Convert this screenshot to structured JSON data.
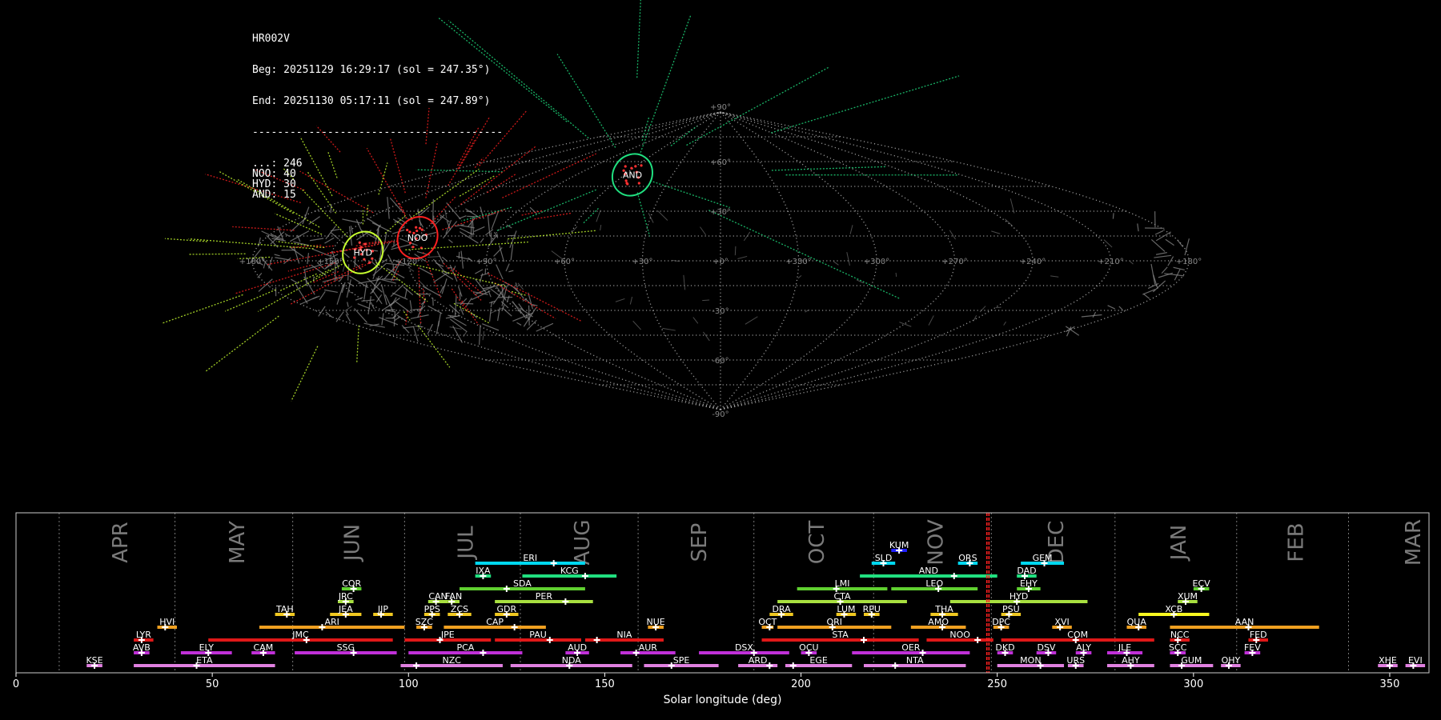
{
  "info": {
    "station": "HR002V",
    "beg": "Beg: 20251129 16:29:17 (sol = 247.35°)",
    "end": "End: 20251130 05:17:11 (sol = 247.89°)",
    "separator": "----------------------------------------",
    "counts": [
      {
        "label": "...",
        "value": 246
      },
      {
        "label": "NOO",
        "value": 40
      },
      {
        "label": "HYD",
        "value": 30
      },
      {
        "label": "AND",
        "value": 15
      }
    ]
  },
  "sky_map": {
    "projection": "sinusoidal",
    "lat_labels": [
      "+90°",
      "+60°",
      "+30°",
      "-30°",
      "-60°",
      "-90°"
    ],
    "lon_labels": [
      "+180°",
      "+150°",
      "+120°",
      "+90°",
      "+60°",
      "+30°",
      "+0°",
      "+330°",
      "+300°",
      "+270°",
      "+240°",
      "+210°",
      "+180°"
    ],
    "colors": {
      "sporadic": "#888888",
      "noo": "#ff2020",
      "hyd": "#c8ff30",
      "and": "#20e080"
    },
    "radiants": [
      {
        "code": "AND",
        "lon": 55,
        "lat": 52,
        "color": "#20e080",
        "count": 15
      },
      {
        "code": "NOO",
        "lon": 120,
        "lat": 14,
        "color": "#ff2020",
        "count": 40
      },
      {
        "code": "HYD",
        "lon": 138,
        "lat": 5,
        "color": "#c8ff30",
        "count": 30
      }
    ]
  },
  "chart_data": {
    "type": "timeline",
    "xlabel": "Solar longitude (deg)",
    "xlim": [
      0,
      360
    ],
    "xticks": [
      0,
      50,
      100,
      150,
      200,
      250,
      300,
      350
    ],
    "current_sol": [
      247.35,
      247.89
    ],
    "months": [
      {
        "name": "APR",
        "start": 11
      },
      {
        "name": "MAY",
        "start": 40.5
      },
      {
        "name": "JUN",
        "start": 70.5
      },
      {
        "name": "JUL",
        "start": 99
      },
      {
        "name": "AUG",
        "start": 128.5
      },
      {
        "name": "SEP",
        "start": 158.5
      },
      {
        "name": "OCT",
        "start": 188
      },
      {
        "name": "NOV",
        "start": 218.5
      },
      {
        "name": "DEC",
        "start": 248.5
      },
      {
        "name": "JAN",
        "start": 280
      },
      {
        "name": "FEB",
        "start": 311
      },
      {
        "name": "MAR",
        "start": 339.5
      }
    ],
    "showers": [
      {
        "code": "KUM",
        "start": 223,
        "end": 227,
        "peak": 225,
        "row": 9,
        "color": "#2020ff"
      },
      {
        "code": "ERI",
        "start": 117,
        "end": 145,
        "peak": 137,
        "row": 8,
        "color": "#00d8f0"
      },
      {
        "code": "SLD",
        "start": 218,
        "end": 224,
        "peak": 221,
        "row": 8,
        "color": "#00d8f0"
      },
      {
        "code": "ORS",
        "start": 240,
        "end": 245,
        "peak": 243,
        "row": 8,
        "color": "#00d8f0"
      },
      {
        "code": "GEM",
        "start": 256,
        "end": 267,
        "peak": 262,
        "row": 8,
        "color": "#00d8f0"
      },
      {
        "code": "IXA",
        "start": 117,
        "end": 121,
        "peak": 119,
        "row": 7,
        "color": "#20e080"
      },
      {
        "code": "KCG",
        "start": 129,
        "end": 153,
        "peak": 145,
        "row": 7,
        "color": "#20e080"
      },
      {
        "code": "AND",
        "start": 215,
        "end": 250,
        "peak": 239,
        "row": 7,
        "color": "#20e080"
      },
      {
        "code": "DAD",
        "start": 255,
        "end": 260,
        "peak": 257,
        "row": 7,
        "color": "#20e080"
      },
      {
        "code": "COR",
        "start": 83,
        "end": 88,
        "peak": 86,
        "row": 6,
        "color": "#60d030"
      },
      {
        "code": "SDA",
        "start": 113,
        "end": 145,
        "peak": 125,
        "row": 6,
        "color": "#60d030"
      },
      {
        "code": "LMI",
        "start": 199,
        "end": 222,
        "peak": 209,
        "row": 6,
        "color": "#60d030"
      },
      {
        "code": "LEO",
        "start": 223,
        "end": 245,
        "peak": 235,
        "row": 6,
        "color": "#60d030"
      },
      {
        "code": "EHY",
        "start": 255,
        "end": 261,
        "peak": 258,
        "row": 6,
        "color": "#60d030"
      },
      {
        "code": "ECV",
        "start": 300,
        "end": 304,
        "peak": 302,
        "row": 6,
        "color": "#60d030"
      },
      {
        "code": "JRC",
        "start": 82,
        "end": 86,
        "peak": 84,
        "row": 5,
        "color": "#a8e040"
      },
      {
        "code": "CAN",
        "start": 105,
        "end": 110,
        "peak": 107,
        "row": 5,
        "color": "#a8e040"
      },
      {
        "code": "FAN",
        "start": 110,
        "end": 113,
        "peak": 111,
        "row": 5,
        "color": "#a8e040"
      },
      {
        "code": "PER",
        "start": 122,
        "end": 147,
        "peak": 140,
        "row": 5,
        "color": "#a8e040"
      },
      {
        "code": "CTA",
        "start": 194,
        "end": 227,
        "peak": 210,
        "row": 5,
        "color": "#a8e040"
      },
      {
        "code": "HYD",
        "start": 238,
        "end": 273,
        "peak": 255,
        "row": 5,
        "color": "#a8e040"
      },
      {
        "code": "XUM",
        "start": 296,
        "end": 301,
        "peak": 298,
        "row": 5,
        "color": "#a8e040"
      },
      {
        "code": "TAH",
        "start": 66,
        "end": 71,
        "peak": 69,
        "row": 4,
        "color": "#f0c820"
      },
      {
        "code": "JEA",
        "start": 80,
        "end": 88,
        "peak": 84,
        "row": 4,
        "color": "#f0c820"
      },
      {
        "code": "JIP",
        "start": 91,
        "end": 96,
        "peak": 93,
        "row": 4,
        "color": "#f0c820"
      },
      {
        "code": "PPS",
        "start": 104,
        "end": 108,
        "peak": 106,
        "row": 4,
        "color": "#f0c820"
      },
      {
        "code": "ZCS",
        "start": 110,
        "end": 116,
        "peak": 113,
        "row": 4,
        "color": "#f0c820"
      },
      {
        "code": "GDR",
        "start": 122,
        "end": 128,
        "peak": 125,
        "row": 4,
        "color": "#f0c820"
      },
      {
        "code": "DRA",
        "start": 192,
        "end": 198,
        "peak": 195,
        "row": 4,
        "color": "#f0c820"
      },
      {
        "code": "LUM",
        "start": 209,
        "end": 214,
        "peak": 211,
        "row": 4,
        "color": "#f0c820"
      },
      {
        "code": "RPU",
        "start": 216,
        "end": 220,
        "peak": 218,
        "row": 4,
        "color": "#f0c820"
      },
      {
        "code": "THA",
        "start": 233,
        "end": 240,
        "peak": 236,
        "row": 4,
        "color": "#f0c820"
      },
      {
        "code": "PSU",
        "start": 251,
        "end": 256,
        "peak": 253,
        "row": 4,
        "color": "#f0c820"
      },
      {
        "code": "XCB",
        "start": 286,
        "end": 304,
        "peak": 295,
        "row": 4,
        "color": "#f8f820"
      },
      {
        "code": "HVI",
        "start": 36,
        "end": 41,
        "peak": 38,
        "row": 3,
        "color": "#f0a020"
      },
      {
        "code": "ARI",
        "start": 62,
        "end": 99,
        "peak": 78,
        "row": 3,
        "color": "#f0a020"
      },
      {
        "code": "SZC",
        "start": 102,
        "end": 106,
        "peak": 104,
        "row": 3,
        "color": "#f0a020"
      },
      {
        "code": "CAP",
        "start": 109,
        "end": 135,
        "peak": 127,
        "row": 3,
        "color": "#f0a020"
      },
      {
        "code": "NUE",
        "start": 161,
        "end": 165,
        "peak": 163,
        "row": 3,
        "color": "#f0a020"
      },
      {
        "code": "OCT",
        "start": 190,
        "end": 193,
        "peak": 192,
        "row": 3,
        "color": "#f0a020"
      },
      {
        "code": "ORI",
        "start": 194,
        "end": 223,
        "peak": 208,
        "row": 3,
        "color": "#f0a020"
      },
      {
        "code": "AMO",
        "start": 228,
        "end": 242,
        "peak": 236,
        "row": 3,
        "color": "#f0a020"
      },
      {
        "code": "DPC",
        "start": 249,
        "end": 253,
        "peak": 251,
        "row": 3,
        "color": "#f0a020"
      },
      {
        "code": "XVI",
        "start": 264,
        "end": 269,
        "peak": 266,
        "row": 3,
        "color": "#f0a020"
      },
      {
        "code": "QUA",
        "start": 283,
        "end": 288,
        "peak": 286,
        "row": 3,
        "color": "#f0a020"
      },
      {
        "code": "AAN",
        "start": 294,
        "end": 332,
        "peak": 314,
        "row": 3,
        "color": "#f0a020"
      },
      {
        "code": "LYR",
        "start": 30,
        "end": 35,
        "peak": 32,
        "row": 2,
        "color": "#e01818"
      },
      {
        "code": "JMC",
        "start": 49,
        "end": 96,
        "peak": 74,
        "row": 2,
        "color": "#e01818"
      },
      {
        "code": "JPE",
        "start": 99,
        "end": 121,
        "peak": 108,
        "row": 2,
        "color": "#e01818"
      },
      {
        "code": "PAU",
        "start": 122,
        "end": 144,
        "peak": 136,
        "row": 2,
        "color": "#e01818"
      },
      {
        "code": "NIA",
        "start": 145,
        "end": 165,
        "peak": 148,
        "row": 2,
        "color": "#e01818"
      },
      {
        "code": "STA",
        "start": 190,
        "end": 230,
        "peak": 216,
        "row": 2,
        "color": "#e01818"
      },
      {
        "code": "NOO",
        "start": 232,
        "end": 249,
        "peak": 245,
        "row": 2,
        "color": "#e01818"
      },
      {
        "code": "COM",
        "start": 251,
        "end": 290,
        "peak": 270,
        "row": 2,
        "color": "#e01818"
      },
      {
        "code": "NCC",
        "start": 294,
        "end": 299,
        "peak": 296,
        "row": 2,
        "color": "#e01818"
      },
      {
        "code": "FED",
        "start": 314,
        "end": 319,
        "peak": 316,
        "row": 2,
        "color": "#e01818"
      },
      {
        "code": "AVB",
        "start": 30,
        "end": 34,
        "peak": 32,
        "row": 1,
        "color": "#c030d8"
      },
      {
        "code": "ELY",
        "start": 42,
        "end": 55,
        "peak": 49,
        "row": 1,
        "color": "#c030d8"
      },
      {
        "code": "CAM",
        "start": 60,
        "end": 66,
        "peak": 63,
        "row": 1,
        "color": "#c030d8"
      },
      {
        "code": "SSG",
        "start": 71,
        "end": 97,
        "peak": 86,
        "row": 1,
        "color": "#c030d8"
      },
      {
        "code": "PCA",
        "start": 100,
        "end": 129,
        "peak": 119,
        "row": 1,
        "color": "#c030d8"
      },
      {
        "code": "AUD",
        "start": 140,
        "end": 146,
        "peak": 143,
        "row": 1,
        "color": "#c030d8"
      },
      {
        "code": "AUR",
        "start": 154,
        "end": 168,
        "peak": 158,
        "row": 1,
        "color": "#c030d8"
      },
      {
        "code": "DSX",
        "start": 174,
        "end": 197,
        "peak": 188,
        "row": 1,
        "color": "#c030d8"
      },
      {
        "code": "OCU",
        "start": 200,
        "end": 204,
        "peak": 202,
        "row": 1,
        "color": "#c030d8"
      },
      {
        "code": "OER",
        "start": 213,
        "end": 243,
        "peak": 231,
        "row": 1,
        "color": "#c030d8"
      },
      {
        "code": "DKD",
        "start": 250,
        "end": 254,
        "peak": 252,
        "row": 1,
        "color": "#c030d8"
      },
      {
        "code": "DSV",
        "start": 260,
        "end": 265,
        "peak": 263,
        "row": 1,
        "color": "#c030d8"
      },
      {
        "code": "ALY",
        "start": 270,
        "end": 274,
        "peak": 272,
        "row": 1,
        "color": "#c030d8"
      },
      {
        "code": "JLE",
        "start": 278,
        "end": 287,
        "peak": 283,
        "row": 1,
        "color": "#c030d8"
      },
      {
        "code": "SCC",
        "start": 294,
        "end": 298,
        "peak": 296,
        "row": 1,
        "color": "#c030d8"
      },
      {
        "code": "FEV",
        "start": 313,
        "end": 317,
        "peak": 315,
        "row": 1,
        "color": "#c030d8"
      },
      {
        "code": "KSE",
        "start": 18,
        "end": 22,
        "peak": 20,
        "row": 0,
        "color": "#e080e0"
      },
      {
        "code": "ETA",
        "start": 30,
        "end": 66,
        "peak": 46,
        "row": 0,
        "color": "#e080e0"
      },
      {
        "code": "NZC",
        "start": 98,
        "end": 124,
        "peak": 102,
        "row": 0,
        "color": "#e080e0"
      },
      {
        "code": "NDA",
        "start": 126,
        "end": 157,
        "peak": 141,
        "row": 0,
        "color": "#e080e0"
      },
      {
        "code": "SPE",
        "start": 160,
        "end": 179,
        "peak": 167,
        "row": 0,
        "color": "#e080e0"
      },
      {
        "code": "ARD",
        "start": 184,
        "end": 194,
        "peak": 192,
        "row": 0,
        "color": "#e080e0"
      },
      {
        "code": "EGE",
        "start": 196,
        "end": 213,
        "peak": 198,
        "row": 0,
        "color": "#e080e0"
      },
      {
        "code": "NTA",
        "start": 216,
        "end": 242,
        "peak": 224,
        "row": 0,
        "color": "#e080e0"
      },
      {
        "code": "MON",
        "start": 250,
        "end": 267,
        "peak": 261,
        "row": 0,
        "color": "#e080e0"
      },
      {
        "code": "URS",
        "start": 268,
        "end": 272,
        "peak": 270,
        "row": 0,
        "color": "#e080e0"
      },
      {
        "code": "AHY",
        "start": 278,
        "end": 290,
        "peak": 284,
        "row": 0,
        "color": "#e080e0"
      },
      {
        "code": "GUM",
        "start": 294,
        "end": 305,
        "peak": 297,
        "row": 0,
        "color": "#e080e0"
      },
      {
        "code": "OHY",
        "start": 307,
        "end": 312,
        "peak": 309,
        "row": 0,
        "color": "#e080e0"
      },
      {
        "code": "XHE",
        "start": 347,
        "end": 352,
        "peak": 350,
        "row": 0,
        "color": "#e080e0"
      },
      {
        "code": "EVI",
        "start": 354,
        "end": 359,
        "peak": 356,
        "row": 0,
        "color": "#e080e0"
      }
    ]
  }
}
